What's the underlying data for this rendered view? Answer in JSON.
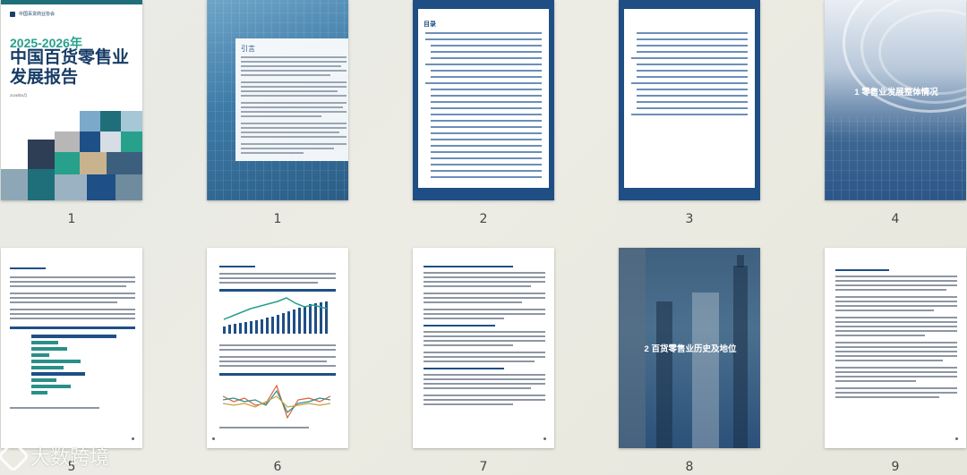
{
  "thumbnails": [
    {
      "page_label": "1",
      "kind": "cover"
    },
    {
      "page_label": "1",
      "kind": "intro"
    },
    {
      "page_label": "2",
      "kind": "toc"
    },
    {
      "page_label": "3",
      "kind": "toc-continued"
    },
    {
      "page_label": "4",
      "kind": "section-divider"
    },
    {
      "page_label": "5",
      "kind": "text-chart"
    },
    {
      "page_label": "6",
      "kind": "text-chart"
    },
    {
      "page_label": "7",
      "kind": "text"
    },
    {
      "page_label": "8",
      "kind": "section-divider"
    },
    {
      "page_label": "9",
      "kind": "text"
    }
  ],
  "cover": {
    "publisher": "中国百货商业协会",
    "year": "2025-2026年",
    "title": "中国百货零售业发展报告",
    "date": "2026年5月"
  },
  "intro": {
    "heading": "引言"
  },
  "toc": {
    "heading": "目录"
  },
  "sections": {
    "s1": "1 零售业发展整体情况",
    "s2": "2 百货零售业历史及地位"
  },
  "watermark": {
    "text": "大数跨境"
  },
  "colors": {
    "navy": "#1f4e84",
    "teal": "#27a08c",
    "cover_title": "#173c66"
  }
}
